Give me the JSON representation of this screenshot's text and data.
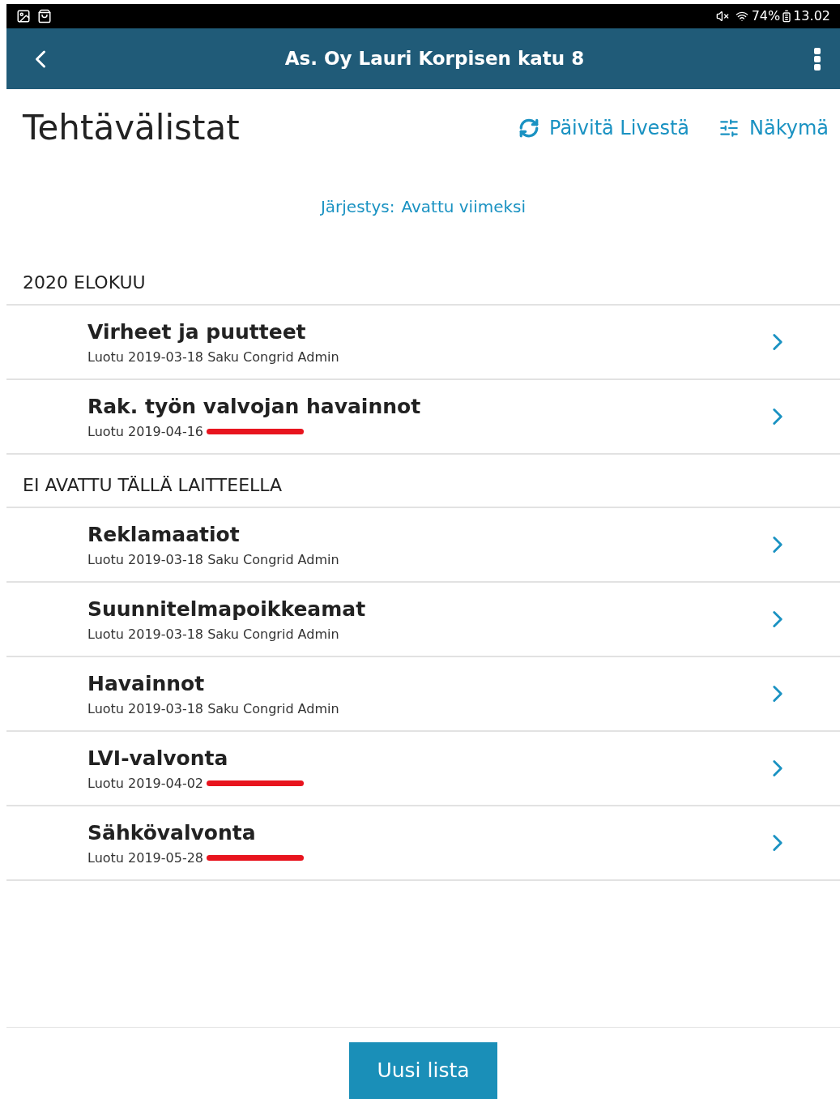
{
  "status_bar": {
    "battery": "74%",
    "time": "13.02"
  },
  "app_bar": {
    "title": "As. Oy Lauri Korpisen katu 8"
  },
  "page": {
    "title": "Tehtävälistat",
    "actions": [
      "Päivitä Livestä",
      "Näkymä"
    ]
  },
  "sort": {
    "label": "Järjestys:",
    "value": "Avattu viimeksi"
  },
  "sections": [
    {
      "title": "2020 ELOKUU",
      "items": [
        {
          "title": "Virheet ja puutteet",
          "subtitle": "Luotu 2019-03-18 Saku Congrid Admin",
          "redacted": false
        },
        {
          "title": "Rak. työn valvojan havainnot",
          "subtitle": "Luotu 2019-04-16",
          "redacted": true
        }
      ]
    },
    {
      "title": "EI AVATTU TÄLLÄ LAITTEELLA",
      "items": [
        {
          "title": "Reklamaatiot",
          "subtitle": "Luotu 2019-03-18 Saku Congrid Admin",
          "redacted": false
        },
        {
          "title": "Suunnitelmapoikkeamat",
          "subtitle": "Luotu 2019-03-18 Saku Congrid Admin",
          "redacted": false
        },
        {
          "title": "Havainnot",
          "subtitle": "Luotu 2019-03-18 Saku Congrid Admin",
          "redacted": false
        },
        {
          "title": "LVI-valvonta",
          "subtitle": "Luotu 2019-04-02",
          "redacted": true
        },
        {
          "title": "Sähkövalvonta",
          "subtitle": "Luotu 2019-05-28",
          "redacted": true
        }
      ]
    }
  ],
  "footer": {
    "button": "Uusi lista"
  }
}
